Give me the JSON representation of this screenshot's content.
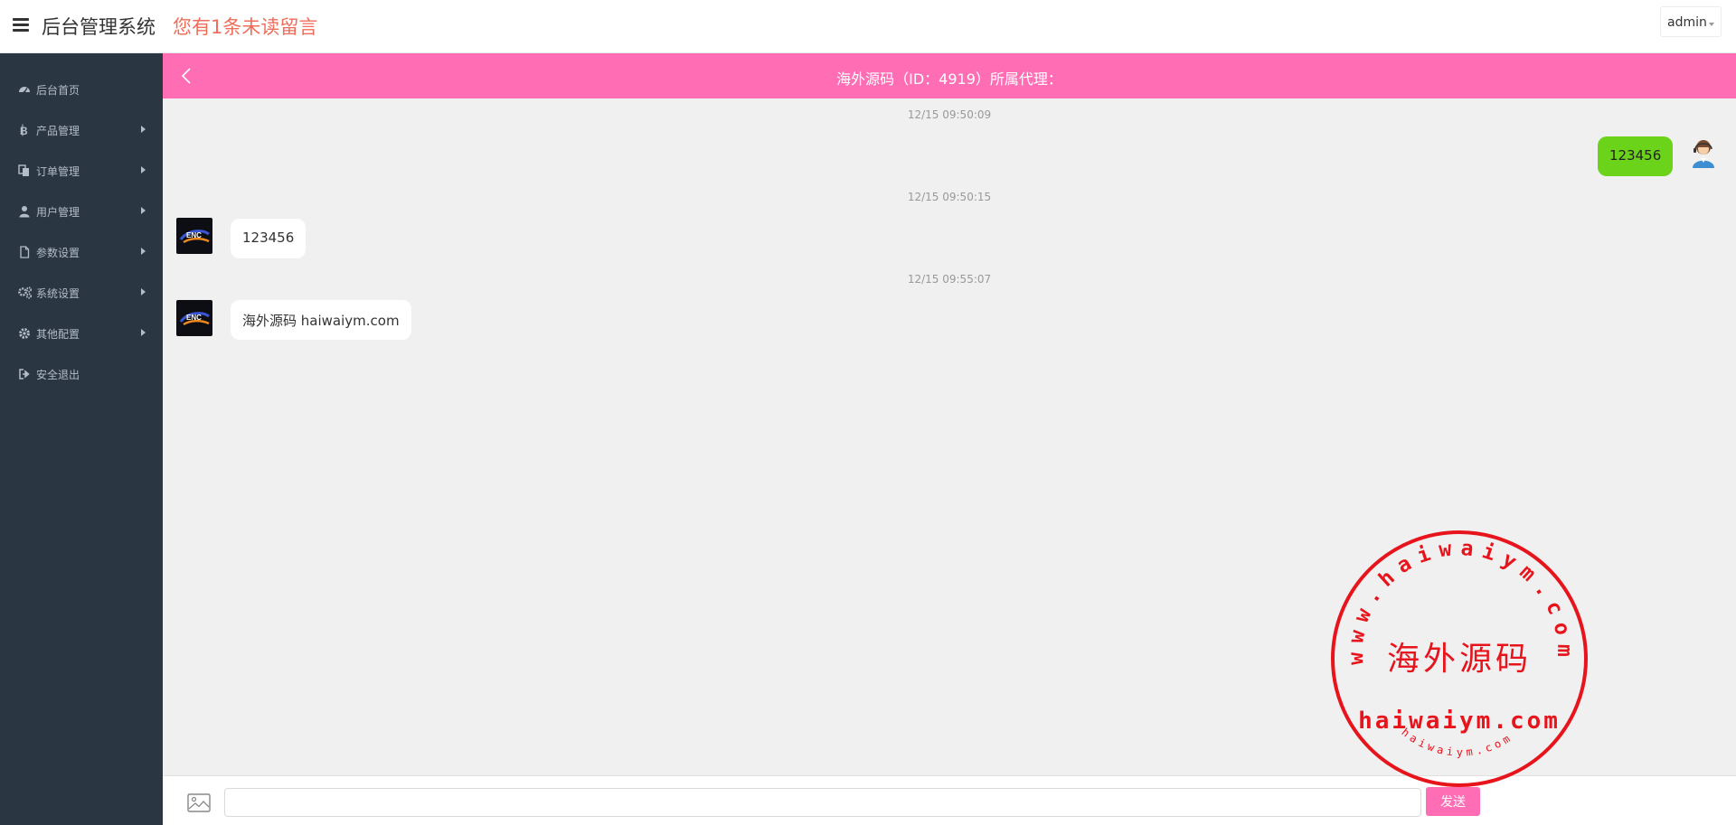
{
  "header": {
    "title": "后台管理系统",
    "unread_notice": "您有1条未读留言",
    "user": "admin"
  },
  "sidebar": {
    "items": [
      {
        "label": "后台首页",
        "icon": "dashboard-icon",
        "has_submenu": false
      },
      {
        "label": "产品管理",
        "icon": "bitcoin-icon",
        "has_submenu": true
      },
      {
        "label": "订单管理",
        "icon": "files-icon",
        "has_submenu": true
      },
      {
        "label": "用户管理",
        "icon": "user-icon",
        "has_submenu": true
      },
      {
        "label": "参数设置",
        "icon": "file-icon",
        "has_submenu": true
      },
      {
        "label": "系统设置",
        "icon": "gears-icon",
        "has_submenu": true
      },
      {
        "label": "其他配置",
        "icon": "gear-icon",
        "has_submenu": true
      },
      {
        "label": "安全退出",
        "icon": "sign-out-icon",
        "has_submenu": false
      }
    ]
  },
  "chat": {
    "title": "海外源码（ID：4919）所属代理：",
    "messages": [
      {
        "time": "12/15 09:50:09",
        "side": "right",
        "text": "123456"
      },
      {
        "time": "12/15 09:50:15",
        "side": "left",
        "text": "123456"
      },
      {
        "time": "12/15 09:55:07",
        "side": "left",
        "text": "海外源码 haiwaiym.com"
      }
    ],
    "brand_avatar_text": "ENC"
  },
  "composer": {
    "send_label": "发送",
    "placeholder": ""
  },
  "watermark": {
    "ring_text": "www.haiwaiym.com",
    "center_text": "海外源码",
    "domain_text": "haiwaiym.com",
    "bottom_text": "haiwaiym.com"
  },
  "colors": {
    "accent_pink": "#ff6eb4",
    "sidebar_bg": "#2b3643",
    "bubble_green": "#6cd31b",
    "notice_red": "#f06d5b",
    "stamp_red": "#e8141c"
  }
}
